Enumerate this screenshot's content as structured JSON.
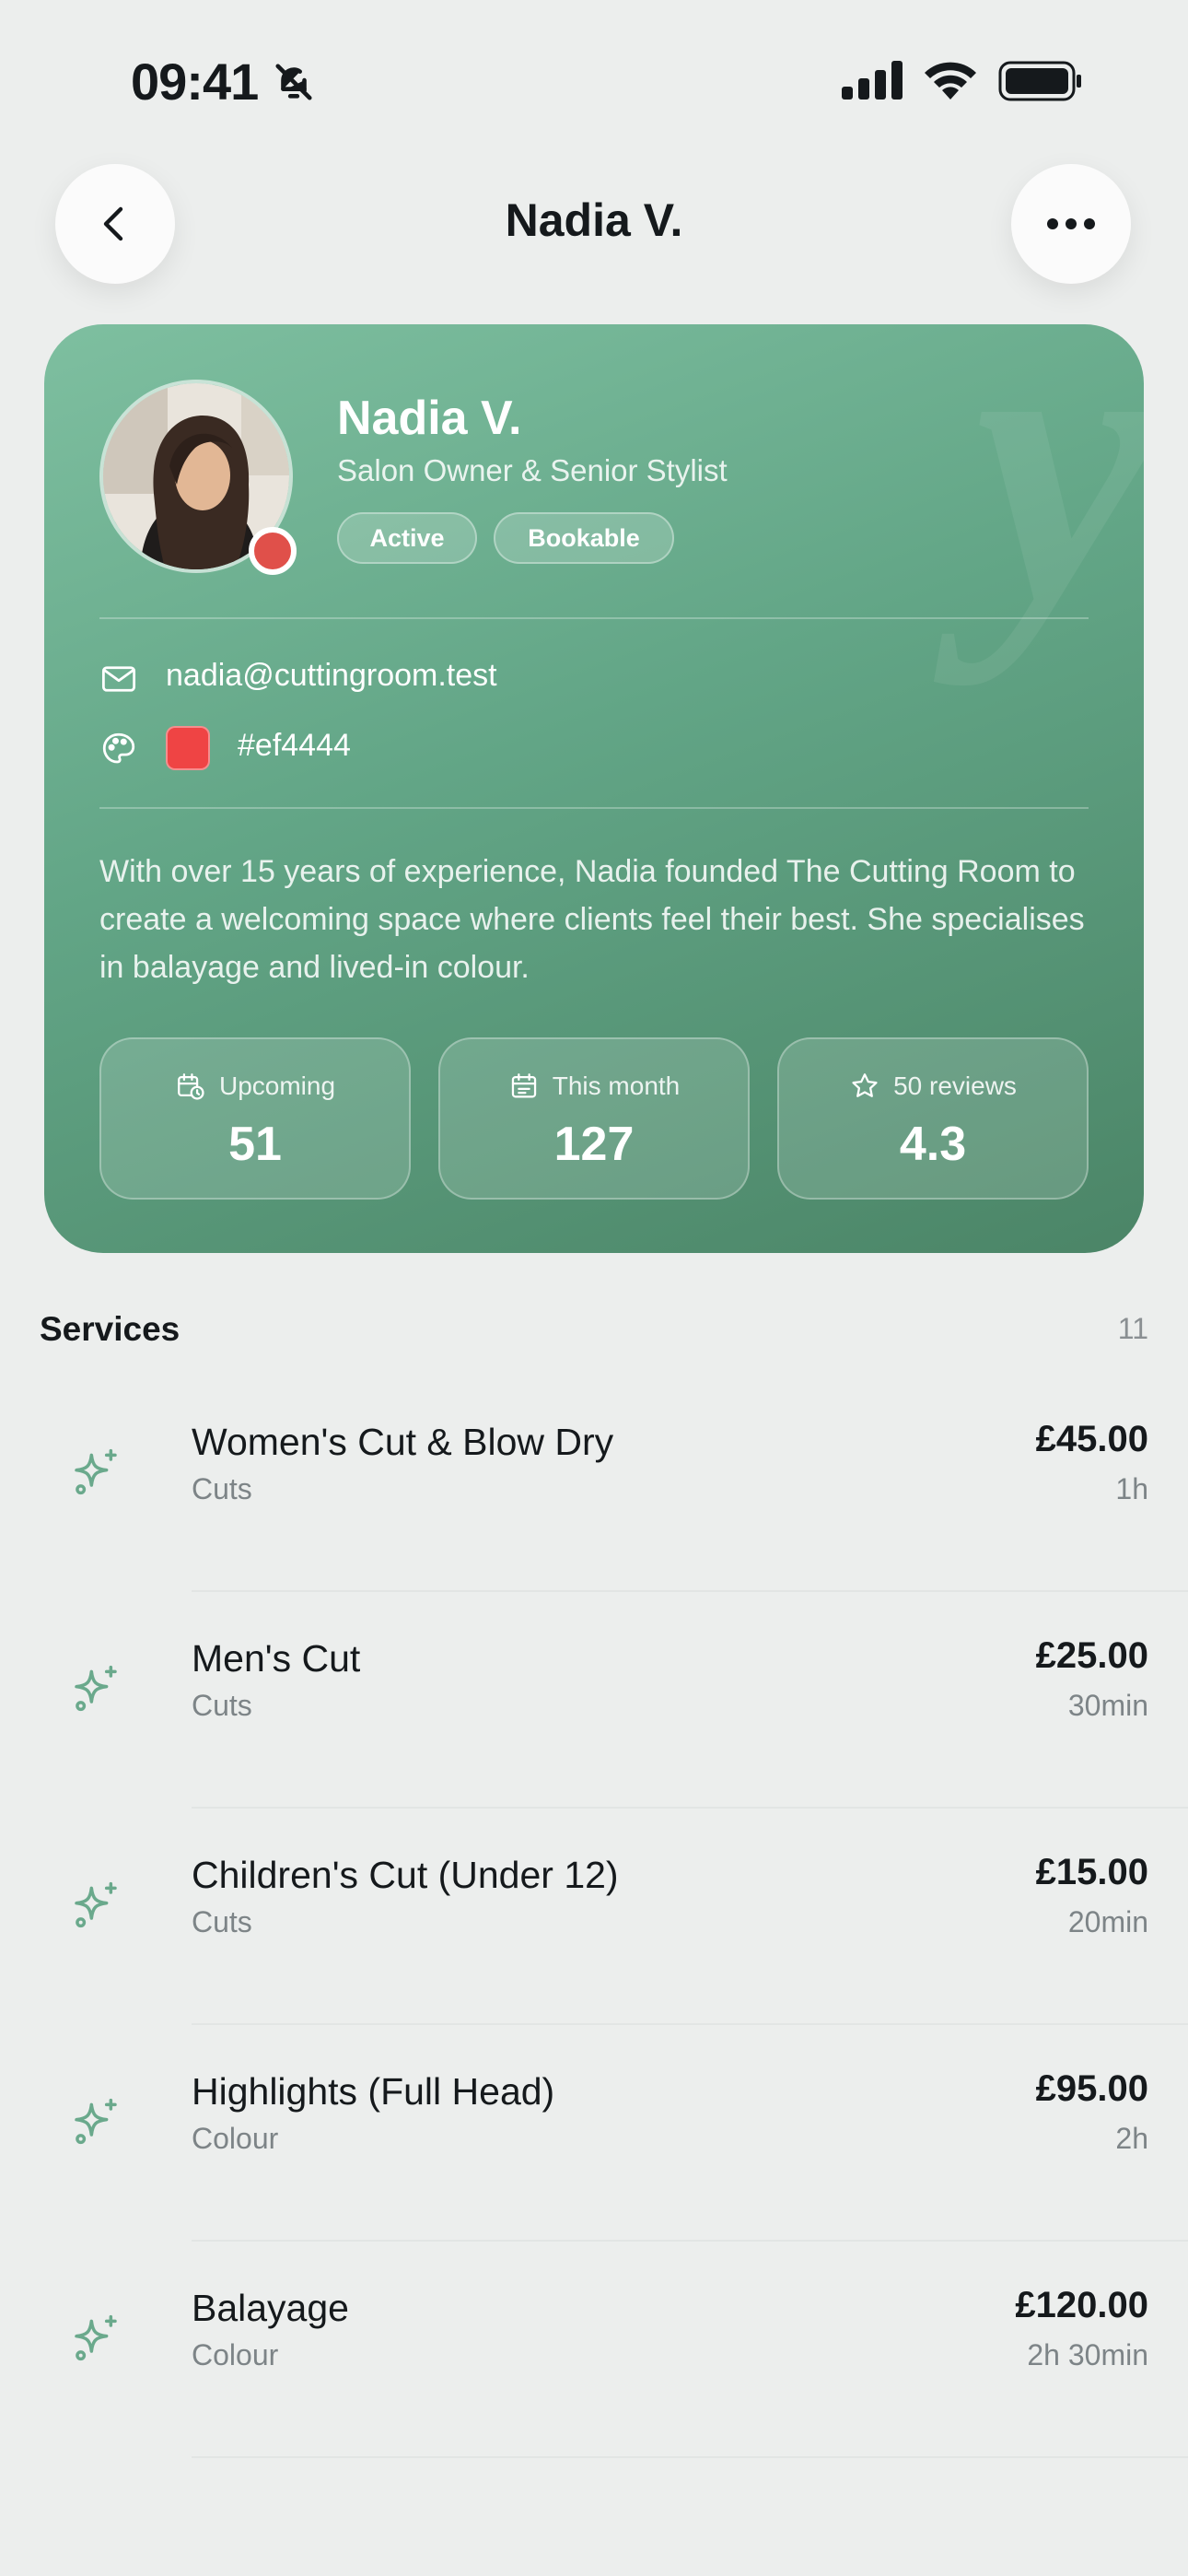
{
  "status_bar": {
    "time": "09:41"
  },
  "nav": {
    "title": "Nadia V."
  },
  "profile": {
    "name": "Nadia V.",
    "role": "Salon Owner & Senior Stylist",
    "badges": [
      "Active",
      "Bookable"
    ],
    "watermark": "y",
    "email": "nadia@cuttingroom.test",
    "color_hex": "#ef4444",
    "bio": "With over 15 years of experience, Nadia founded The Cutting Room to create a welcoming space where clients feel their best. She specialises in balayage and lived-in colour.",
    "stats": [
      {
        "icon": "calendar-clock-icon",
        "label": "Upcoming",
        "value": "51"
      },
      {
        "icon": "calendar-icon",
        "label": "This month",
        "value": "127"
      },
      {
        "icon": "star-icon",
        "label": "50 reviews",
        "value": "4.3"
      }
    ]
  },
  "services": {
    "title": "Services",
    "count": "11",
    "items": [
      {
        "name": "Women's Cut & Blow Dry",
        "category": "Cuts",
        "price": "£45.00",
        "duration": "1h"
      },
      {
        "name": "Men's Cut",
        "category": "Cuts",
        "price": "£25.00",
        "duration": "30min"
      },
      {
        "name": "Children's Cut (Under 12)",
        "category": "Cuts",
        "price": "£15.00",
        "duration": "20min"
      },
      {
        "name": "Highlights (Full Head)",
        "category": "Colour",
        "price": "£95.00",
        "duration": "2h"
      },
      {
        "name": "Balayage",
        "category": "Colour",
        "price": "£120.00",
        "duration": "2h 30min"
      }
    ]
  },
  "colors": {
    "accent": "#62a586",
    "status_dot": "#e0504a",
    "swatch": "#ef4444"
  }
}
